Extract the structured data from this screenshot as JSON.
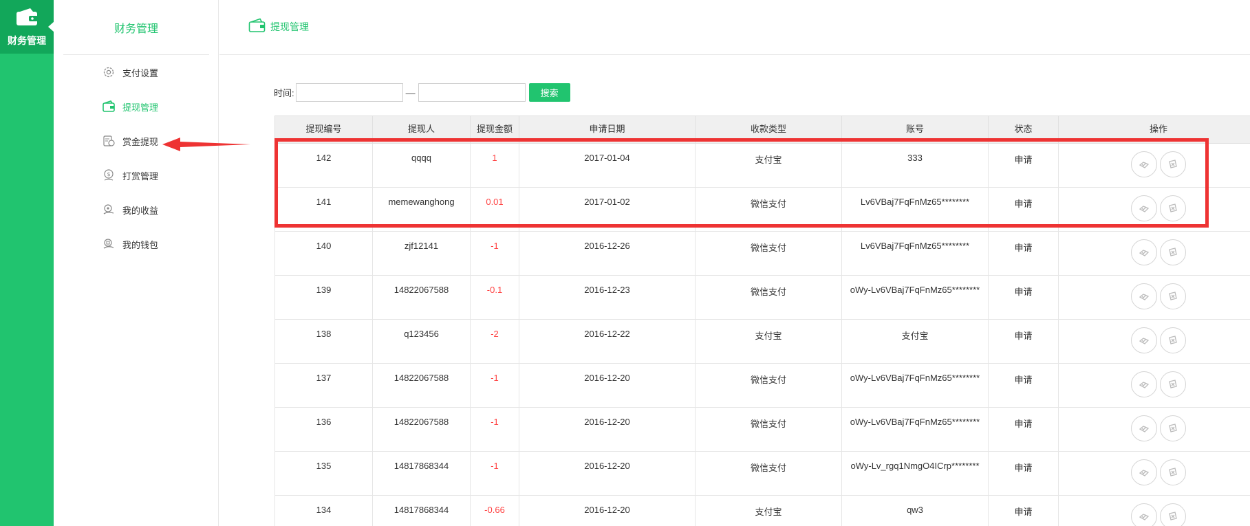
{
  "rail": {
    "label": "财务管理"
  },
  "sidebar": {
    "title": "财务管理",
    "items": [
      {
        "label": "支付设置",
        "icon": "gear-icon",
        "active": false
      },
      {
        "label": "提现管理",
        "icon": "wallet-icon",
        "active": true
      },
      {
        "label": "赏金提现",
        "icon": "coins-icon",
        "active": false
      },
      {
        "label": "打赏管理",
        "icon": "tip-coin-icon",
        "active": false
      },
      {
        "label": "我的收益",
        "icon": "earnings-icon",
        "active": false
      },
      {
        "label": "我的钱包",
        "icon": "purse-icon",
        "active": false
      }
    ]
  },
  "header": {
    "title": "提现管理"
  },
  "filter": {
    "time_label": "时间:",
    "separator": "—",
    "start_value": "",
    "end_value": "",
    "search_label": "搜索"
  },
  "table": {
    "columns": [
      "提现编号",
      "提现人",
      "提现金额",
      "申请日期",
      "收款类型",
      "账号",
      "状态",
      "操作"
    ],
    "rows": [
      {
        "id": "142",
        "user": "qqqq",
        "amount": "1",
        "date": "2017-01-04",
        "type": "支付宝",
        "account": "333",
        "status": "申请"
      },
      {
        "id": "141",
        "user": "memewanghong",
        "amount": "0.01",
        "date": "2017-01-02",
        "type": "微信支付",
        "account": "Lv6VBaj7FqFnMz65********",
        "status": "申请"
      },
      {
        "id": "140",
        "user": "zjf12141",
        "amount": "-1",
        "date": "2016-12-26",
        "type": "微信支付",
        "account": "Lv6VBaj7FqFnMz65********",
        "status": "申请"
      },
      {
        "id": "139",
        "user": "14822067588",
        "amount": "-0.1",
        "date": "2016-12-23",
        "type": "微信支付",
        "account": "oWy-Lv6VBaj7FqFnMz65********",
        "status": "申请"
      },
      {
        "id": "138",
        "user": "q123456",
        "amount": "-2",
        "date": "2016-12-22",
        "type": "支付宝",
        "account": "支付宝",
        "status": "申请"
      },
      {
        "id": "137",
        "user": "14822067588",
        "amount": "-1",
        "date": "2016-12-20",
        "type": "微信支付",
        "account": "oWy-Lv6VBaj7FqFnMz65********",
        "status": "申请"
      },
      {
        "id": "136",
        "user": "14822067588",
        "amount": "-1",
        "date": "2016-12-20",
        "type": "微信支付",
        "account": "oWy-Lv6VBaj7FqFnMz65********",
        "status": "申请"
      },
      {
        "id": "135",
        "user": "14817868344",
        "amount": "-1",
        "date": "2016-12-20",
        "type": "微信支付",
        "account": "oWy-Lv_rgq1NmgO4ICrp********",
        "status": "申请"
      },
      {
        "id": "134",
        "user": "14817868344",
        "amount": "-0.66",
        "date": "2016-12-20",
        "type": "支付宝",
        "account": "qw3",
        "status": "申请"
      }
    ]
  },
  "colors": {
    "brand": "#21c46f",
    "brand_dark": "#12a75a",
    "negative": "#ff4040",
    "annotation": "#ee3333"
  }
}
